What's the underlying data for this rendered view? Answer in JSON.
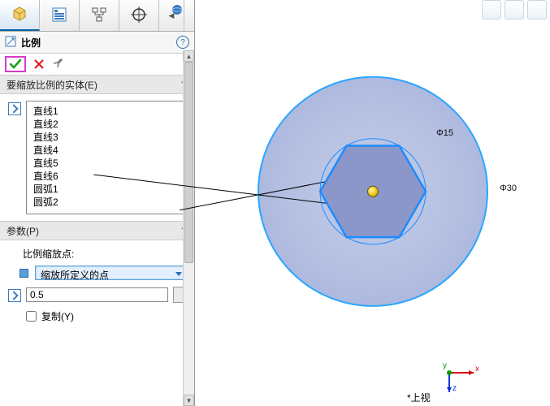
{
  "feature": {
    "title": "比例",
    "entities_header": "要缩放比例的实体(E)",
    "params_header": "参数(P)",
    "scale_point_label": "比例缩放点:",
    "scale_point_option": "缩放所定义的点",
    "scale_factor": "0.5",
    "copy_label": "复制(Y)",
    "copy_checked": false,
    "entities": [
      "直线1",
      "直线2",
      "直线3",
      "直线4",
      "直线5",
      "直线6",
      "圆弧1",
      "圆弧2"
    ]
  },
  "dims": {
    "d1": "Φ15",
    "d2": "Φ30"
  },
  "view_label": "*上视",
  "triad": {
    "x": "x",
    "y": "y",
    "z": "z"
  }
}
